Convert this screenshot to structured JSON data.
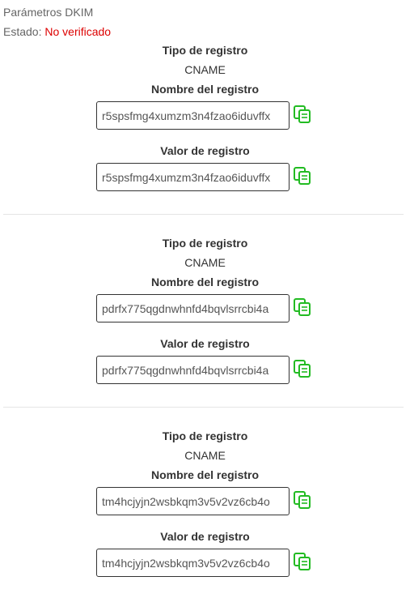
{
  "header": {
    "title": "Parámetros DKIM",
    "status_label": "Estado:",
    "status_value": "No verificado"
  },
  "labels": {
    "record_type": "Tipo de registro",
    "record_name": "Nombre del registro",
    "record_value": "Valor de registro"
  },
  "records": [
    {
      "type": "CNAME",
      "name": "r5spsfmg4xumzm3n4fzao6iduvffx",
      "value": "r5spsfmg4xumzm3n4fzao6iduvffx"
    },
    {
      "type": "CNAME",
      "name": "pdrfx775qgdnwhnfd4bqvlsrrcbi4a",
      "value": "pdrfx775qgdnwhnfd4bqvlsrrcbi4a"
    },
    {
      "type": "CNAME",
      "name": "tm4hcjyjn2wsbkqm3v5v2vz6cb4o",
      "value": "tm4hcjyjn2wsbkqm3v5v2vz6cb4o"
    }
  ],
  "colors": {
    "status_error": "#dd0000",
    "copy_icon": "#22bb22"
  }
}
